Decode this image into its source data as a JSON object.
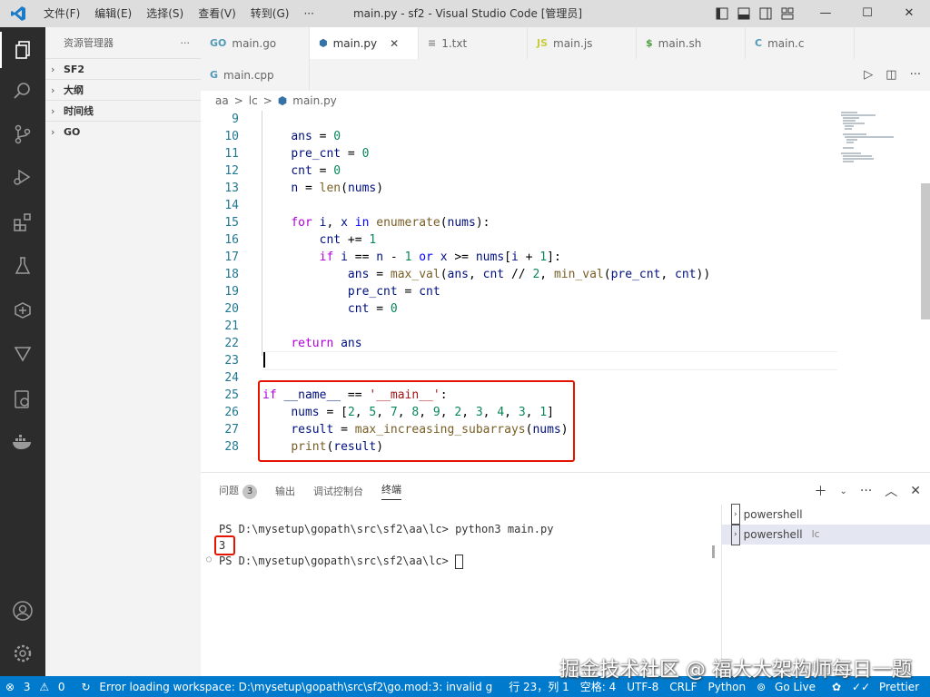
{
  "titlebar": {
    "menu": [
      "文件(F)",
      "编辑(E)",
      "选择(S)",
      "查看(V)",
      "转到(G)",
      "···"
    ],
    "title": "main.py - sf2 - Visual Studio Code [管理员]",
    "minimize": "—",
    "maximize": "☐",
    "close": "✕"
  },
  "sidebar": {
    "title": "资源管理器",
    "more": "···",
    "sections": [
      "SF2",
      "大纲",
      "时间线",
      "GO"
    ]
  },
  "tabs_row1": [
    {
      "icon": "GO",
      "label": "main.go",
      "color": "#519aba"
    },
    {
      "icon": "py",
      "label": "main.py",
      "color": "#3572a5",
      "active": true
    },
    {
      "icon": "≡",
      "label": "1.txt",
      "color": "#888"
    },
    {
      "icon": "JS",
      "label": "main.js",
      "color": "#cbcb41"
    },
    {
      "icon": "$",
      "label": "main.sh",
      "color": "#4d9f44"
    },
    {
      "icon": "C",
      "label": "main.c",
      "color": "#519aba"
    }
  ],
  "tabs_row2": [
    {
      "icon": "G",
      "label": "main.cpp",
      "color": "#519aba"
    }
  ],
  "breadcrumb": [
    "aa",
    ">",
    "lc",
    ">",
    "main.py"
  ],
  "editor": {
    "lines": [
      {
        "n": "9",
        "code": ""
      },
      {
        "n": "10",
        "code": "    ans = 0"
      },
      {
        "n": "11",
        "code": "    pre_cnt = 0"
      },
      {
        "n": "12",
        "code": "    cnt = 0"
      },
      {
        "n": "13",
        "code": "    n = len(nums)"
      },
      {
        "n": "14",
        "code": ""
      },
      {
        "n": "15",
        "code": "    for i, x in enumerate(nums):"
      },
      {
        "n": "16",
        "code": "        cnt += 1"
      },
      {
        "n": "17",
        "code": "        if i == n - 1 or x >= nums[i + 1]:"
      },
      {
        "n": "18",
        "code": "            ans = max_val(ans, cnt // 2, min_val(pre_cnt, cnt))"
      },
      {
        "n": "19",
        "code": "            pre_cnt = cnt"
      },
      {
        "n": "20",
        "code": "            cnt = 0"
      },
      {
        "n": "21",
        "code": ""
      },
      {
        "n": "22",
        "code": "    return ans"
      },
      {
        "n": "23",
        "code": ""
      },
      {
        "n": "24",
        "code": ""
      },
      {
        "n": "25",
        "code": "if __name__ == '__main__':"
      },
      {
        "n": "26",
        "code": "    nums = [2, 5, 7, 8, 9, 2, 3, 4, 3, 1]"
      },
      {
        "n": "27",
        "code": "    result = max_increasing_subarrays(nums)"
      },
      {
        "n": "28",
        "code": "    print(result)"
      }
    ]
  },
  "panel": {
    "tabs": [
      "问题",
      "输出",
      "调试控制台",
      "终端"
    ],
    "problems_count": "3",
    "active_tab": "终端",
    "terminal_lines": [
      "PS D:\\mysetup\\gopath\\src\\sf2\\aa\\lc> python3 main.py",
      "3",
      "PS D:\\mysetup\\gopath\\src\\sf2\\aa\\lc> "
    ],
    "terminals": [
      {
        "label": "powershell",
        "suffix": ""
      },
      {
        "label": "powershell",
        "suffix": "lc"
      }
    ]
  },
  "statusbar": {
    "errors": "3",
    "warnings": "0",
    "message": "Error loading workspace: D:\\mysetup\\gopath\\src\\sf2\\go.mod:3: invalid g",
    "position": "行 23，列 1",
    "spaces": "空格: 4",
    "encoding": "UTF-8",
    "eol": "CRLF",
    "language": "Python",
    "golive": "Go Live",
    "prettier": "Prettier"
  },
  "watermark": "掘金技术社区 @ 福大大架构师每日一题"
}
